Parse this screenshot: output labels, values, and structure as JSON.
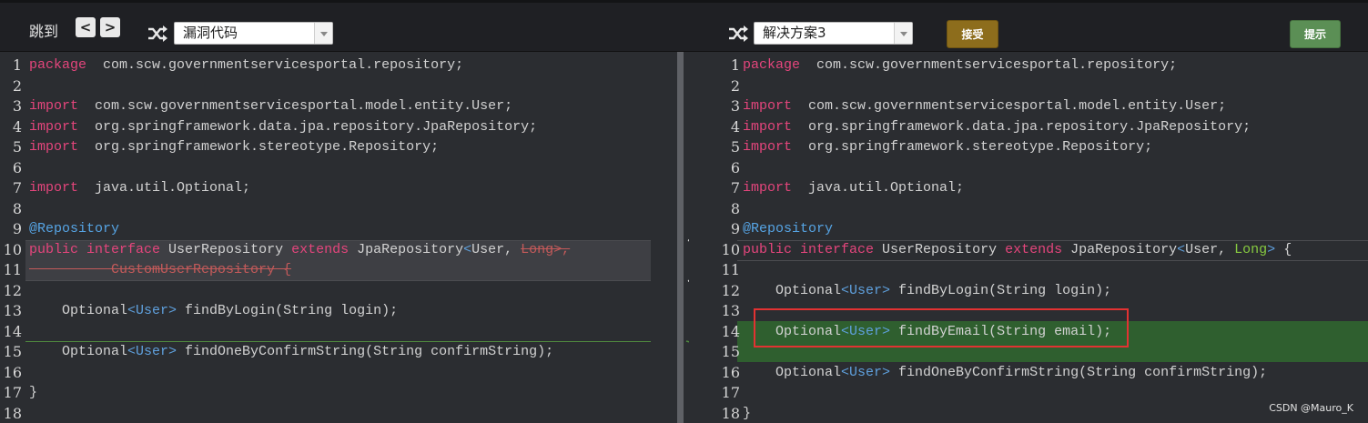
{
  "toolbar": {
    "jump_label": "跳到",
    "prev_button": "<",
    "next_button": ">",
    "left_select": "漏洞代码",
    "right_select": "解决方案3",
    "accept_button": "接受",
    "hint_button": "提示"
  },
  "left_lines": [
    {
      "n": "1",
      "segs": [
        [
          "kw",
          "package"
        ],
        [
          "",
          "  com.scw.governmentservicesportal.repository;"
        ]
      ]
    },
    {
      "n": "2",
      "segs": []
    },
    {
      "n": "3",
      "segs": [
        [
          "kw",
          "import"
        ],
        [
          "",
          "  com.scw.governmentservicesportal.model.entity.User;"
        ]
      ]
    },
    {
      "n": "4",
      "segs": [
        [
          "kw",
          "import"
        ],
        [
          "",
          "  org.springframework.data.jpa.repository.JpaRepository;"
        ]
      ]
    },
    {
      "n": "5",
      "segs": [
        [
          "kw",
          "import"
        ],
        [
          "",
          "  org.springframework.stereotype.Repository;"
        ]
      ]
    },
    {
      "n": "6",
      "segs": []
    },
    {
      "n": "7",
      "segs": [
        [
          "kw",
          "import"
        ],
        [
          "",
          "  java.util.Optional;"
        ]
      ]
    },
    {
      "n": "8",
      "segs": []
    },
    {
      "n": "9",
      "segs": [
        [
          "ann",
          "@Repository"
        ]
      ]
    },
    {
      "n": "10",
      "segs": [
        [
          "kw",
          "public"
        ],
        [
          "",
          " "
        ],
        [
          "kw",
          "interface"
        ],
        [
          "",
          " UserRepository "
        ],
        [
          "kw",
          "extends"
        ],
        [
          "",
          " JpaRepository"
        ],
        [
          "gen",
          "<"
        ],
        [
          "",
          "User, "
        ],
        [
          "del",
          "Long>,"
        ]
      ]
    },
    {
      "n": "11",
      "segs": [
        [
          "del",
          "          CustomUserRepository {"
        ]
      ]
    },
    {
      "n": "12",
      "segs": []
    },
    {
      "n": "13",
      "segs": [
        [
          "",
          "    Optional"
        ],
        [
          "gen",
          "<User>"
        ],
        [
          "",
          " findByLogin(String login);"
        ]
      ]
    },
    {
      "n": "14",
      "segs": []
    },
    {
      "n": "15",
      "segs": [
        [
          "",
          "    Optional"
        ],
        [
          "gen",
          "<User>"
        ],
        [
          "",
          " findOneByConfirmString(String confirmString);"
        ]
      ]
    },
    {
      "n": "16",
      "segs": []
    },
    {
      "n": "17",
      "segs": [
        [
          "",
          "}"
        ]
      ]
    },
    {
      "n": "18",
      "segs": []
    }
  ],
  "right_lines": [
    {
      "n": "1",
      "segs": [
        [
          "kw",
          "package"
        ],
        [
          "",
          "  com.scw.governmentservicesportal.repository;"
        ]
      ]
    },
    {
      "n": "2",
      "segs": []
    },
    {
      "n": "3",
      "segs": [
        [
          "kw",
          "import"
        ],
        [
          "",
          "  com.scw.governmentservicesportal.model.entity.User;"
        ]
      ]
    },
    {
      "n": "4",
      "segs": [
        [
          "kw",
          "import"
        ],
        [
          "",
          "  org.springframework.data.jpa.repository.JpaRepository;"
        ]
      ]
    },
    {
      "n": "5",
      "segs": [
        [
          "kw",
          "import"
        ],
        [
          "",
          "  org.springframework.stereotype.Repository;"
        ]
      ]
    },
    {
      "n": "6",
      "segs": []
    },
    {
      "n": "7",
      "segs": [
        [
          "kw",
          "import"
        ],
        [
          "",
          "  java.util.Optional;"
        ]
      ]
    },
    {
      "n": "8",
      "segs": []
    },
    {
      "n": "9",
      "segs": [
        [
          "ann",
          "@Repository"
        ]
      ]
    },
    {
      "n": "10",
      "segs": [
        [
          "kw",
          "public"
        ],
        [
          "",
          " "
        ],
        [
          "kw",
          "interface"
        ],
        [
          "",
          " UserRepository "
        ],
        [
          "kw",
          "extends"
        ],
        [
          "",
          " JpaRepository"
        ],
        [
          "gen",
          "<"
        ],
        [
          "",
          "User, "
        ],
        [
          "lg",
          "Long"
        ],
        [
          "gen",
          ">"
        ],
        [
          "",
          " {"
        ]
      ]
    },
    {
      "n": "11",
      "segs": []
    },
    {
      "n": "12",
      "segs": [
        [
          "",
          "    Optional"
        ],
        [
          "gen",
          "<User>"
        ],
        [
          "",
          " findByLogin(String login);"
        ]
      ]
    },
    {
      "n": "13",
      "segs": []
    },
    {
      "n": "14",
      "segs": [
        [
          "",
          "    Optional"
        ],
        [
          "gen",
          "<User>"
        ],
        [
          "",
          " findByEmail(String email);"
        ]
      ]
    },
    {
      "n": "15",
      "segs": []
    },
    {
      "n": "16",
      "segs": [
        [
          "",
          "    Optional"
        ],
        [
          "gen",
          "<User>"
        ],
        [
          "",
          " findOneByConfirmString(String confirmString);"
        ]
      ]
    },
    {
      "n": "17",
      "segs": []
    },
    {
      "n": "18",
      "segs": [
        [
          "",
          "}"
        ]
      ]
    }
  ],
  "watermark": "CSDN @Mauro_K",
  "colors": {
    "keyword": "#e4457c",
    "annotation": "#56a4e4",
    "generic": "#5fa0dd",
    "accept": "#8d6d1c",
    "hint": "#5b8f55",
    "highlight_box": "#e23232"
  }
}
